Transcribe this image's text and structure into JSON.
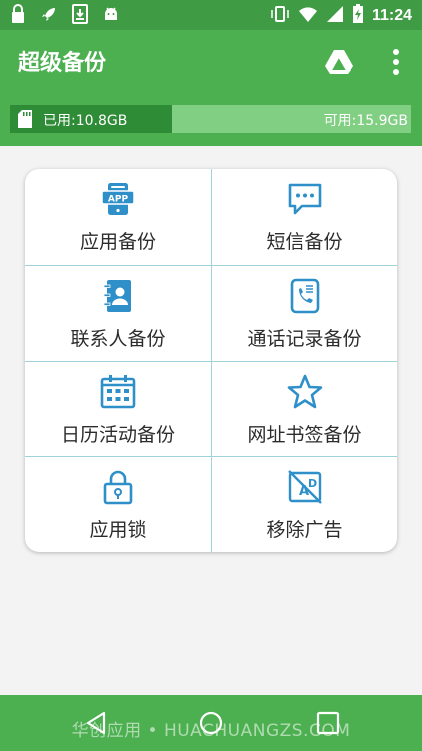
{
  "status_bar": {
    "time": "11:24",
    "left_icons": [
      "lock-icon",
      "rocket-icon",
      "download-icon",
      "android-icon"
    ],
    "right_icons": [
      "vibrate-icon",
      "wifi-icon",
      "signal-icon",
      "battery-charging-icon"
    ]
  },
  "app_bar": {
    "title": "超级备份",
    "actions": [
      "google-drive-icon",
      "more-vert-icon"
    ]
  },
  "storage": {
    "used_label": "已用:10.8GB",
    "available_label": "可用:15.9GB",
    "used_fraction": 0.404
  },
  "grid": {
    "items": [
      {
        "label": "应用备份",
        "icon": "app-icon"
      },
      {
        "label": "短信备份",
        "icon": "sms-icon"
      },
      {
        "label": "联系人备份",
        "icon": "contacts-icon"
      },
      {
        "label": "通话记录备份",
        "icon": "call-log-icon"
      },
      {
        "label": "日历活动备份",
        "icon": "calendar-icon"
      },
      {
        "label": "网址书签备份",
        "icon": "bookmark-star-icon"
      },
      {
        "label": "应用锁",
        "icon": "lock-icon"
      },
      {
        "label": "移除广告",
        "icon": "remove-ads-icon"
      }
    ]
  },
  "nav_bar": {
    "buttons": [
      "back-icon",
      "home-icon",
      "recents-icon"
    ]
  },
  "watermark": "华创应用 • HUACHUANGZS.COM",
  "colors": {
    "status_bar": "#3f9c45",
    "primary": "#4caf50",
    "used_fill": "#2e8b36",
    "available_fill": "#80cf83",
    "icon_accent": "#2f8fc8",
    "divider": "#9fd3dc"
  }
}
